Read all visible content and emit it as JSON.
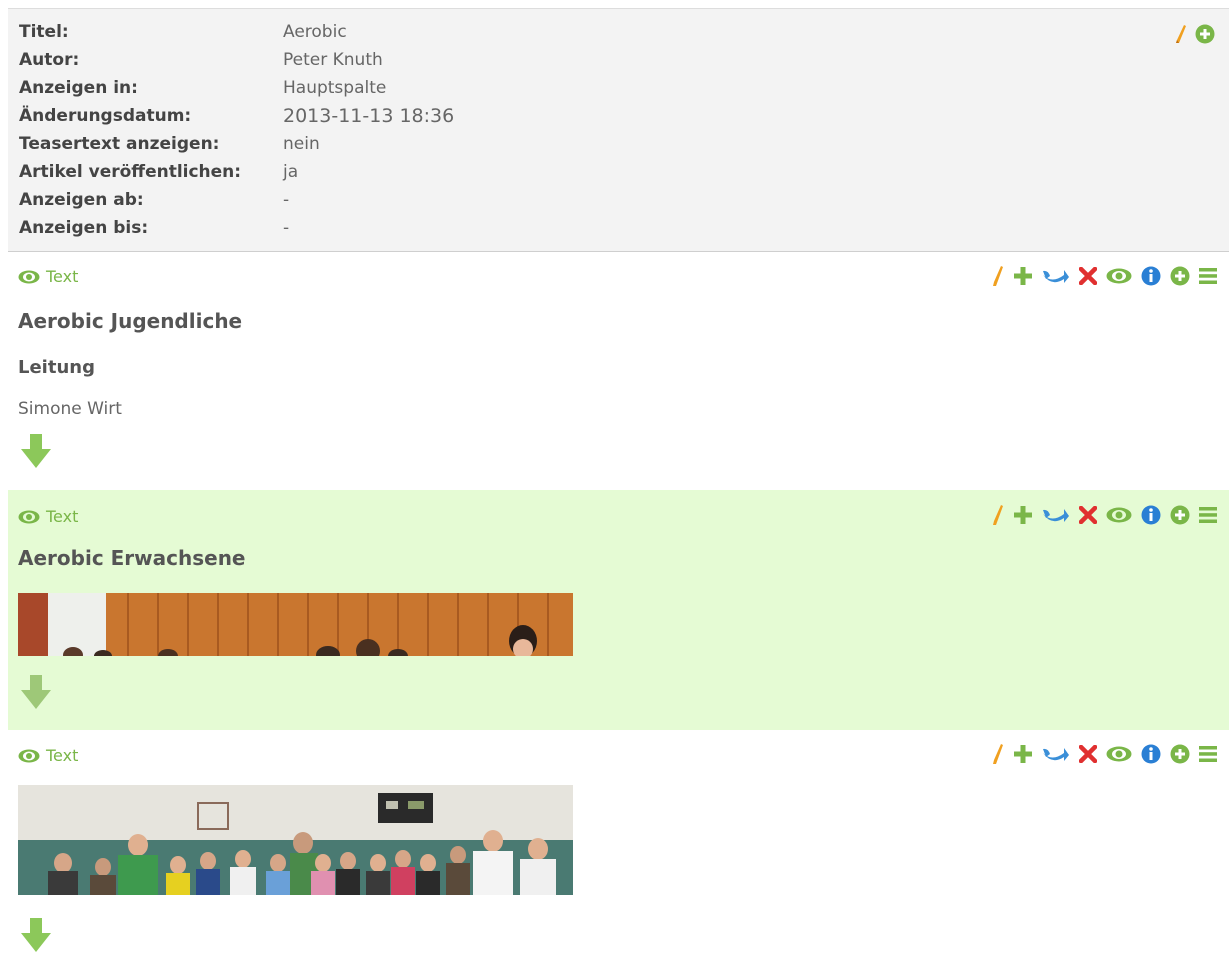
{
  "meta": {
    "rows": [
      {
        "label": "Titel:",
        "value": "Aerobic"
      },
      {
        "label": "Autor:",
        "value": "Peter Knuth"
      },
      {
        "label": "Anzeigen in:",
        "value": "Hauptspalte"
      },
      {
        "label": "Änderungsdatum:",
        "value": "2013-11-13 18:36"
      },
      {
        "label": "Teasertext anzeigen:",
        "value": "nein"
      },
      {
        "label": "Artikel veröffentlichen:",
        "value": "ja"
      },
      {
        "label": "Anzeigen ab:",
        "value": "-"
      },
      {
        "label": "Anzeigen bis:",
        "value": "-"
      }
    ],
    "actions": [
      "edit-icon",
      "add-circle-icon"
    ]
  },
  "blocks": [
    {
      "type_label": "Text",
      "heading": "Aerobic Jugendliche",
      "subheading": "Leitung",
      "paragraph": "Simone Wirt"
    },
    {
      "type_label": "Text",
      "heading": "Aerobic Erwachsene"
    },
    {
      "type_label": "Text"
    }
  ],
  "block_actions": [
    "edit-icon",
    "add-icon",
    "move-icon",
    "delete-icon",
    "visibility-icon",
    "info-icon",
    "add-circle-icon",
    "menu-icon"
  ],
  "colors": {
    "highlight_bg": "#e5fbd4",
    "accent_green": "#7ab648",
    "meta_bg": "#f3f3f3",
    "edit_orange": "#f0a020",
    "delete_red": "#e03030",
    "info_blue": "#2a7fd4"
  }
}
